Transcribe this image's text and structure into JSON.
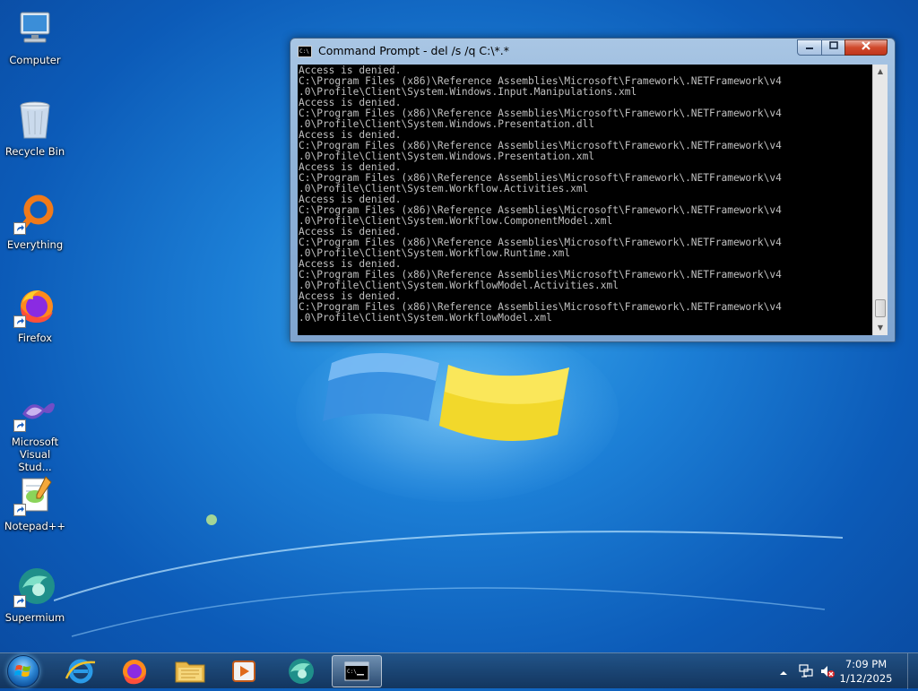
{
  "desktop": {
    "icons": [
      {
        "label": "Computer",
        "icon": "computer-icon"
      },
      {
        "label": "Recycle Bin",
        "icon": "recycle-bin-icon"
      },
      {
        "label": "Everything",
        "icon": "everything-icon"
      },
      {
        "label": "Firefox",
        "icon": "firefox-icon"
      },
      {
        "label": "Microsoft Visual Stud...",
        "icon": "visual-studio-icon"
      },
      {
        "label": "Notepad++",
        "icon": "notepadpp-icon"
      },
      {
        "label": "Supermium",
        "icon": "supermium-icon"
      }
    ]
  },
  "cmd": {
    "title": "Command Prompt - del  /s /q C:\\*.*",
    "buttons": {
      "minimize": "minimize",
      "maximize": "maximize",
      "close": "close"
    },
    "lines": [
      "Access is denied.",
      "C:\\Program Files (x86)\\Reference Assemblies\\Microsoft\\Framework\\.NETFramework\\v4",
      ".0\\Profile\\Client\\System.Windows.Input.Manipulations.xml",
      "Access is denied.",
      "C:\\Program Files (x86)\\Reference Assemblies\\Microsoft\\Framework\\.NETFramework\\v4",
      ".0\\Profile\\Client\\System.Windows.Presentation.dll",
      "Access is denied.",
      "C:\\Program Files (x86)\\Reference Assemblies\\Microsoft\\Framework\\.NETFramework\\v4",
      ".0\\Profile\\Client\\System.Windows.Presentation.xml",
      "Access is denied.",
      "C:\\Program Files (x86)\\Reference Assemblies\\Microsoft\\Framework\\.NETFramework\\v4",
      ".0\\Profile\\Client\\System.Workflow.Activities.xml",
      "Access is denied.",
      "C:\\Program Files (x86)\\Reference Assemblies\\Microsoft\\Framework\\.NETFramework\\v4",
      ".0\\Profile\\Client\\System.Workflow.ComponentModel.xml",
      "Access is denied.",
      "C:\\Program Files (x86)\\Reference Assemblies\\Microsoft\\Framework\\.NETFramework\\v4",
      ".0\\Profile\\Client\\System.Workflow.Runtime.xml",
      "Access is denied.",
      "C:\\Program Files (x86)\\Reference Assemblies\\Microsoft\\Framework\\.NETFramework\\v4",
      ".0\\Profile\\Client\\System.WorkflowModel.Activities.xml",
      "Access is denied.",
      "C:\\Program Files (x86)\\Reference Assemblies\\Microsoft\\Framework\\.NETFramework\\v4",
      ".0\\Profile\\Client\\System.WorkflowModel.xml"
    ]
  },
  "taskbar": {
    "items": [
      "internet-explorer",
      "firefox",
      "file-explorer",
      "media-player",
      "supermium",
      "command-prompt"
    ],
    "active_item": "command-prompt",
    "clock": {
      "time": "7:09 PM",
      "date": "1/12/2025"
    }
  },
  "colors": {
    "console_bg": "#000000",
    "console_text": "#c0c0c0",
    "desktop_blue": "#1c7fd6"
  }
}
